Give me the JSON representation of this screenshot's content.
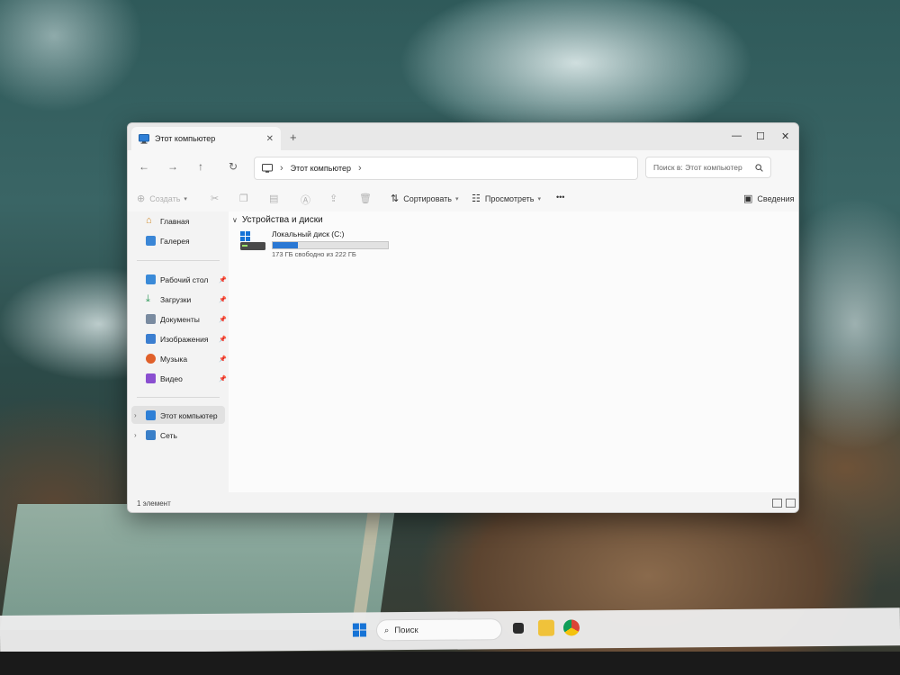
{
  "window": {
    "tab_title": "Этот компьютер",
    "tab_close": "✕",
    "new_tab": "+",
    "controls": {
      "minimize": "—",
      "maximize": "☐",
      "close": "✕"
    }
  },
  "address": {
    "back": "←",
    "forward": "→",
    "up": "↑",
    "refresh": "↻",
    "path": "Этот компьютер",
    "path_chevron": "›",
    "search_placeholder": "Поиск в: Этот компьютер"
  },
  "toolbar": {
    "create": "Создать",
    "sort": "Сортировать",
    "view": "Просмотреть",
    "more": "•••",
    "details": "Сведения"
  },
  "sidebar": {
    "home": "Главная",
    "gallery": "Галерея",
    "quick_access": [
      {
        "label": "Рабочий стол",
        "icon": "desktop-folder-icon",
        "color": "#3a8ad8"
      },
      {
        "label": "Загрузки",
        "icon": "downloads-folder-icon",
        "color": "#2f9a5a"
      },
      {
        "label": "Документы",
        "icon": "documents-folder-icon",
        "color": "#7a8ba0"
      },
      {
        "label": "Изображения",
        "icon": "pictures-folder-icon",
        "color": "#3b7ed0"
      },
      {
        "label": "Музыка",
        "icon": "music-folder-icon",
        "color": "#e0602a"
      },
      {
        "label": "Видео",
        "icon": "videos-folder-icon",
        "color": "#8a4fd0"
      }
    ],
    "this_pc": "Этот компьютер",
    "network": "Сеть"
  },
  "content": {
    "group_header": "Устройства и диски",
    "drive": {
      "name": "Локальный диск (C:)",
      "space_text": "173 ГБ свободно из 222 ГБ",
      "used_fraction": 0.22
    }
  },
  "status": {
    "count": "1 элемент"
  },
  "taskbar": {
    "search": "Поиск"
  },
  "colors": {
    "accent": "#2a78d4",
    "windows_blue": "#1673d6"
  }
}
